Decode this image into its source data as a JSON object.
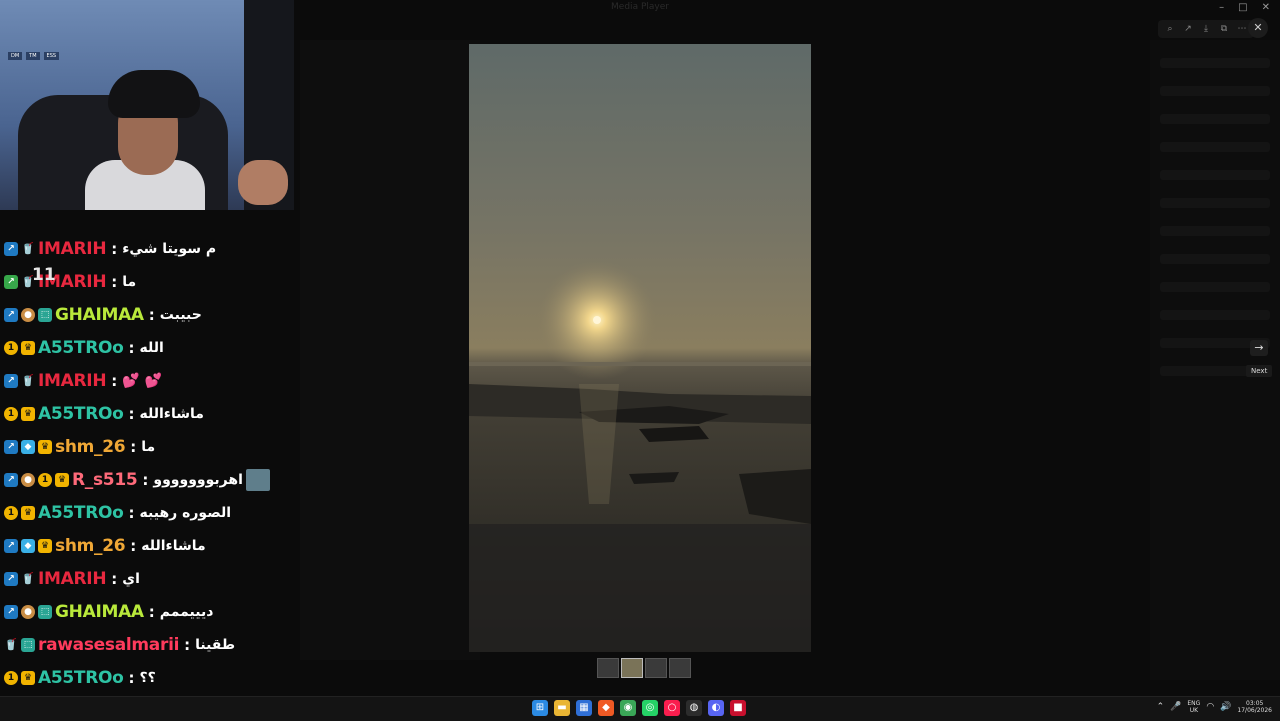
{
  "window": {
    "title": "Media Player"
  },
  "viewer": {
    "next_tooltip": "Next",
    "thumbnails": 4,
    "active_thumbnail": 2
  },
  "webcam": {
    "stickers": [
      "DM",
      "TM",
      "ESS"
    ]
  },
  "overlay_number": "11",
  "chat": {
    "messages": [
      {
        "user": "IMARIH",
        "text": "م سويتا شيء",
        "color": "#e8283f",
        "badges": [
          "mod",
          "cup"
        ]
      },
      {
        "user": "IMARIH",
        "text": "ما",
        "color": "#e8283f",
        "badges": [
          "green",
          "cup"
        ]
      },
      {
        "user": "GHAIMAA",
        "text": "حبيبت",
        "color": "#b9e93b",
        "badges": [
          "mod",
          "cookie",
          "sub"
        ]
      },
      {
        "user": "A55TROo",
        "text": "الله",
        "color": "#2ec3a4",
        "badges": [
          "one",
          "crown"
        ]
      },
      {
        "user": "IMARIH",
        "text": "💕 💕",
        "color": "#e8283f",
        "badges": [
          "mod",
          "cup"
        ]
      },
      {
        "user": "A55TROo",
        "text": "ماشاءالله",
        "color": "#2ec3a4",
        "badges": [
          "one",
          "crown"
        ]
      },
      {
        "user": "shm_26",
        "text": "ما",
        "color": "#f0a836",
        "badges": [
          "mod",
          "cube",
          "crown"
        ]
      },
      {
        "user": "R_s515",
        "text": "اهربووووووو",
        "color": "#ff6a7a",
        "badges": [
          "mod",
          "cookie",
          "one",
          "crown"
        ],
        "avatar": true
      },
      {
        "user": "A55TROo",
        "text": "الصوره رهيبه",
        "color": "#2ec3a4",
        "badges": [
          "one",
          "crown"
        ]
      },
      {
        "user": "shm_26",
        "text": "ماشاءالله",
        "color": "#f0a836",
        "badges": [
          "mod",
          "cube",
          "crown"
        ]
      },
      {
        "user": "IMARIH",
        "text": "اي",
        "color": "#e8283f",
        "badges": [
          "mod",
          "cup"
        ]
      },
      {
        "user": "GHAIMAA",
        "text": "ديييممم",
        "color": "#b9e93b",
        "badges": [
          "mod",
          "cookie",
          "sub"
        ]
      },
      {
        "user": "rawasesalmarii",
        "text": "طقينا",
        "color": "#ff3b5c",
        "badges": [
          "cup",
          "sub"
        ]
      },
      {
        "user": "A55TROo",
        "text": "؟؟",
        "color": "#2ec3a4",
        "badges": [
          "one",
          "crown"
        ]
      }
    ]
  },
  "taskbar": {
    "apps": [
      "windows-start",
      "file-explorer",
      "calendar",
      "brave",
      "chrome",
      "whatsapp",
      "opera-gx",
      "obs",
      "discord",
      "red-app"
    ],
    "lang": "ENG",
    "region": "UK",
    "time": "03:05",
    "date": "17/06/2026"
  },
  "colors": {
    "mod": "#1f7ac2",
    "taskbar": "#141414"
  }
}
